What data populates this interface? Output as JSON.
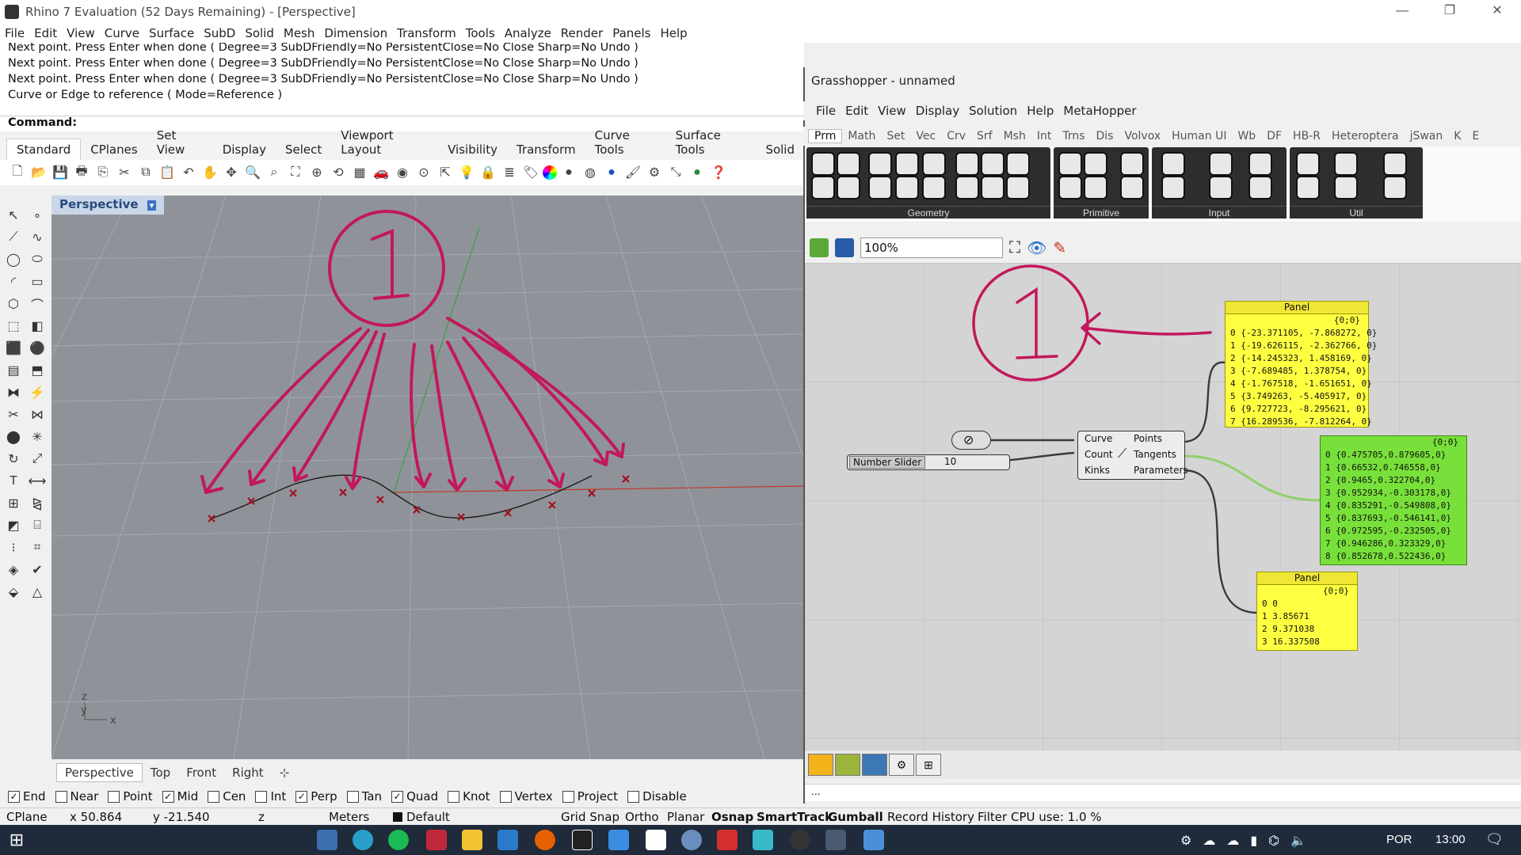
{
  "window": {
    "title": "Rhino 7 Evaluation (52 Days Remaining) - [Perspective]"
  },
  "menu": [
    "File",
    "Edit",
    "View",
    "Curve",
    "Surface",
    "SubD",
    "Solid",
    "Mesh",
    "Dimension",
    "Transform",
    "Tools",
    "Analyze",
    "Render",
    "Panels",
    "Help"
  ],
  "command_history": [
    "Next point. Press Enter when done ( Degree=3  SubDFriendly=No  PersistentClose=No  Close  Sharp=No  Undo )",
    "Next point. Press Enter when done ( Degree=3  SubDFriendly=No  PersistentClose=No  Close  Sharp=No  Undo )",
    "Next point. Press Enter when done ( Degree=3  SubDFriendly=No  PersistentClose=No  Close  Sharp=No  Undo )",
    "Curve or Edge to reference ( Mode=Reference )"
  ],
  "command_prompt": "Command:",
  "toolbar_tabs": [
    "Standard",
    "CPlanes",
    "Set View",
    "Display",
    "Select",
    "Viewport Layout",
    "Visibility",
    "Transform",
    "Curve Tools",
    "Surface Tools",
    "Solid"
  ],
  "viewport": {
    "title": "Perspective",
    "tabs": [
      "Perspective",
      "Top",
      "Front",
      "Right"
    ],
    "axis": {
      "z": "z",
      "y": "y",
      "x": "x"
    }
  },
  "osnaps": [
    {
      "label": "End",
      "checked": true
    },
    {
      "label": "Near",
      "checked": false
    },
    {
      "label": "Point",
      "checked": false
    },
    {
      "label": "Mid",
      "checked": true
    },
    {
      "label": "Cen",
      "checked": false
    },
    {
      "label": "Int",
      "checked": false
    },
    {
      "label": "Perp",
      "checked": true
    },
    {
      "label": "Tan",
      "checked": false
    },
    {
      "label": "Quad",
      "checked": true
    },
    {
      "label": "Knot",
      "checked": false
    },
    {
      "label": "Vertex",
      "checked": false
    },
    {
      "label": "Project",
      "checked": false
    },
    {
      "label": "Disable",
      "checked": false
    }
  ],
  "status": {
    "cplane": "CPlane",
    "x": "x 50.864",
    "y": "y -21.540",
    "z": "z",
    "units": "Meters",
    "layer": "Default",
    "items": [
      "Grid Snap",
      "Ortho",
      "Planar",
      "Osnap",
      "SmartTrack",
      "Gumball",
      "Record History",
      "Filter",
      "CPU use: 1.0 %"
    ]
  },
  "taskbar": {
    "lang": "POR",
    "time": "13:00"
  },
  "grasshopper": {
    "title": "Grasshopper - unnamed",
    "menu": [
      "File",
      "Edit",
      "View",
      "Display",
      "Solution",
      "Help",
      "MetaHopper"
    ],
    "tabs": [
      "Prm",
      "Math",
      "Set",
      "Vec",
      "Crv",
      "Srf",
      "Msh",
      "Int",
      "Trns",
      "Dis",
      "Volvox",
      "Human UI",
      "Wb",
      "DF",
      "HB-R",
      "Heteroptera",
      "jSwan",
      "K",
      "E"
    ],
    "groups": [
      "Geometry",
      "Primitive",
      "Input",
      "Util"
    ],
    "zoom": "100%",
    "status": "...",
    "panel1": {
      "title": "Panel",
      "path": "{0;0}",
      "rows": [
        "0 {-23.371105, -7.868272, 0}",
        "1 {-19.626115, -2.362766, 0}",
        "2 {-14.245323, 1.458169, 0}",
        "3 {-7.689485, 1.378754, 0}",
        "4 {-1.767518, -1.651651, 0}",
        "5 {3.749263, -5.405917, 0}",
        "6 {9.727723, -8.295621, 0}",
        "7 {16.289536, -7.812264, 0}"
      ]
    },
    "panel2": {
      "path": "{0;0}",
      "rows": [
        "0 {0.475705,0.879605,0}",
        "1 {0.66532,0.746558,0}",
        "2 {0.9465,0.322704,0}",
        "3 {0.952934,-0.303178,0}",
        "4 {0.835291,-0.549808,0}",
        "5 {0.837693,-0.546141,0}",
        "6 {0.972595,-0.232505,0}",
        "7 {0.946286,0.323329,0}",
        "8 {0.852678,0.522436,0}"
      ]
    },
    "panel3": {
      "title": "Panel",
      "path": "{0;0}",
      "rows": [
        "0 0",
        "1 3.85671",
        "2 9.371038",
        "3 16.337508"
      ]
    },
    "divide": {
      "in": [
        "Curve",
        "Count",
        "Kinks"
      ],
      "out": [
        "Points",
        "Tangents",
        "Parameters"
      ]
    },
    "slider": {
      "label": "Number Slider",
      "value": "10"
    }
  },
  "annotation": {
    "label": "1",
    "color": "#c2185b"
  },
  "colors": {
    "accent": "#c2185b",
    "panel": "#ffff42",
    "panel_green": "#78e03a"
  }
}
